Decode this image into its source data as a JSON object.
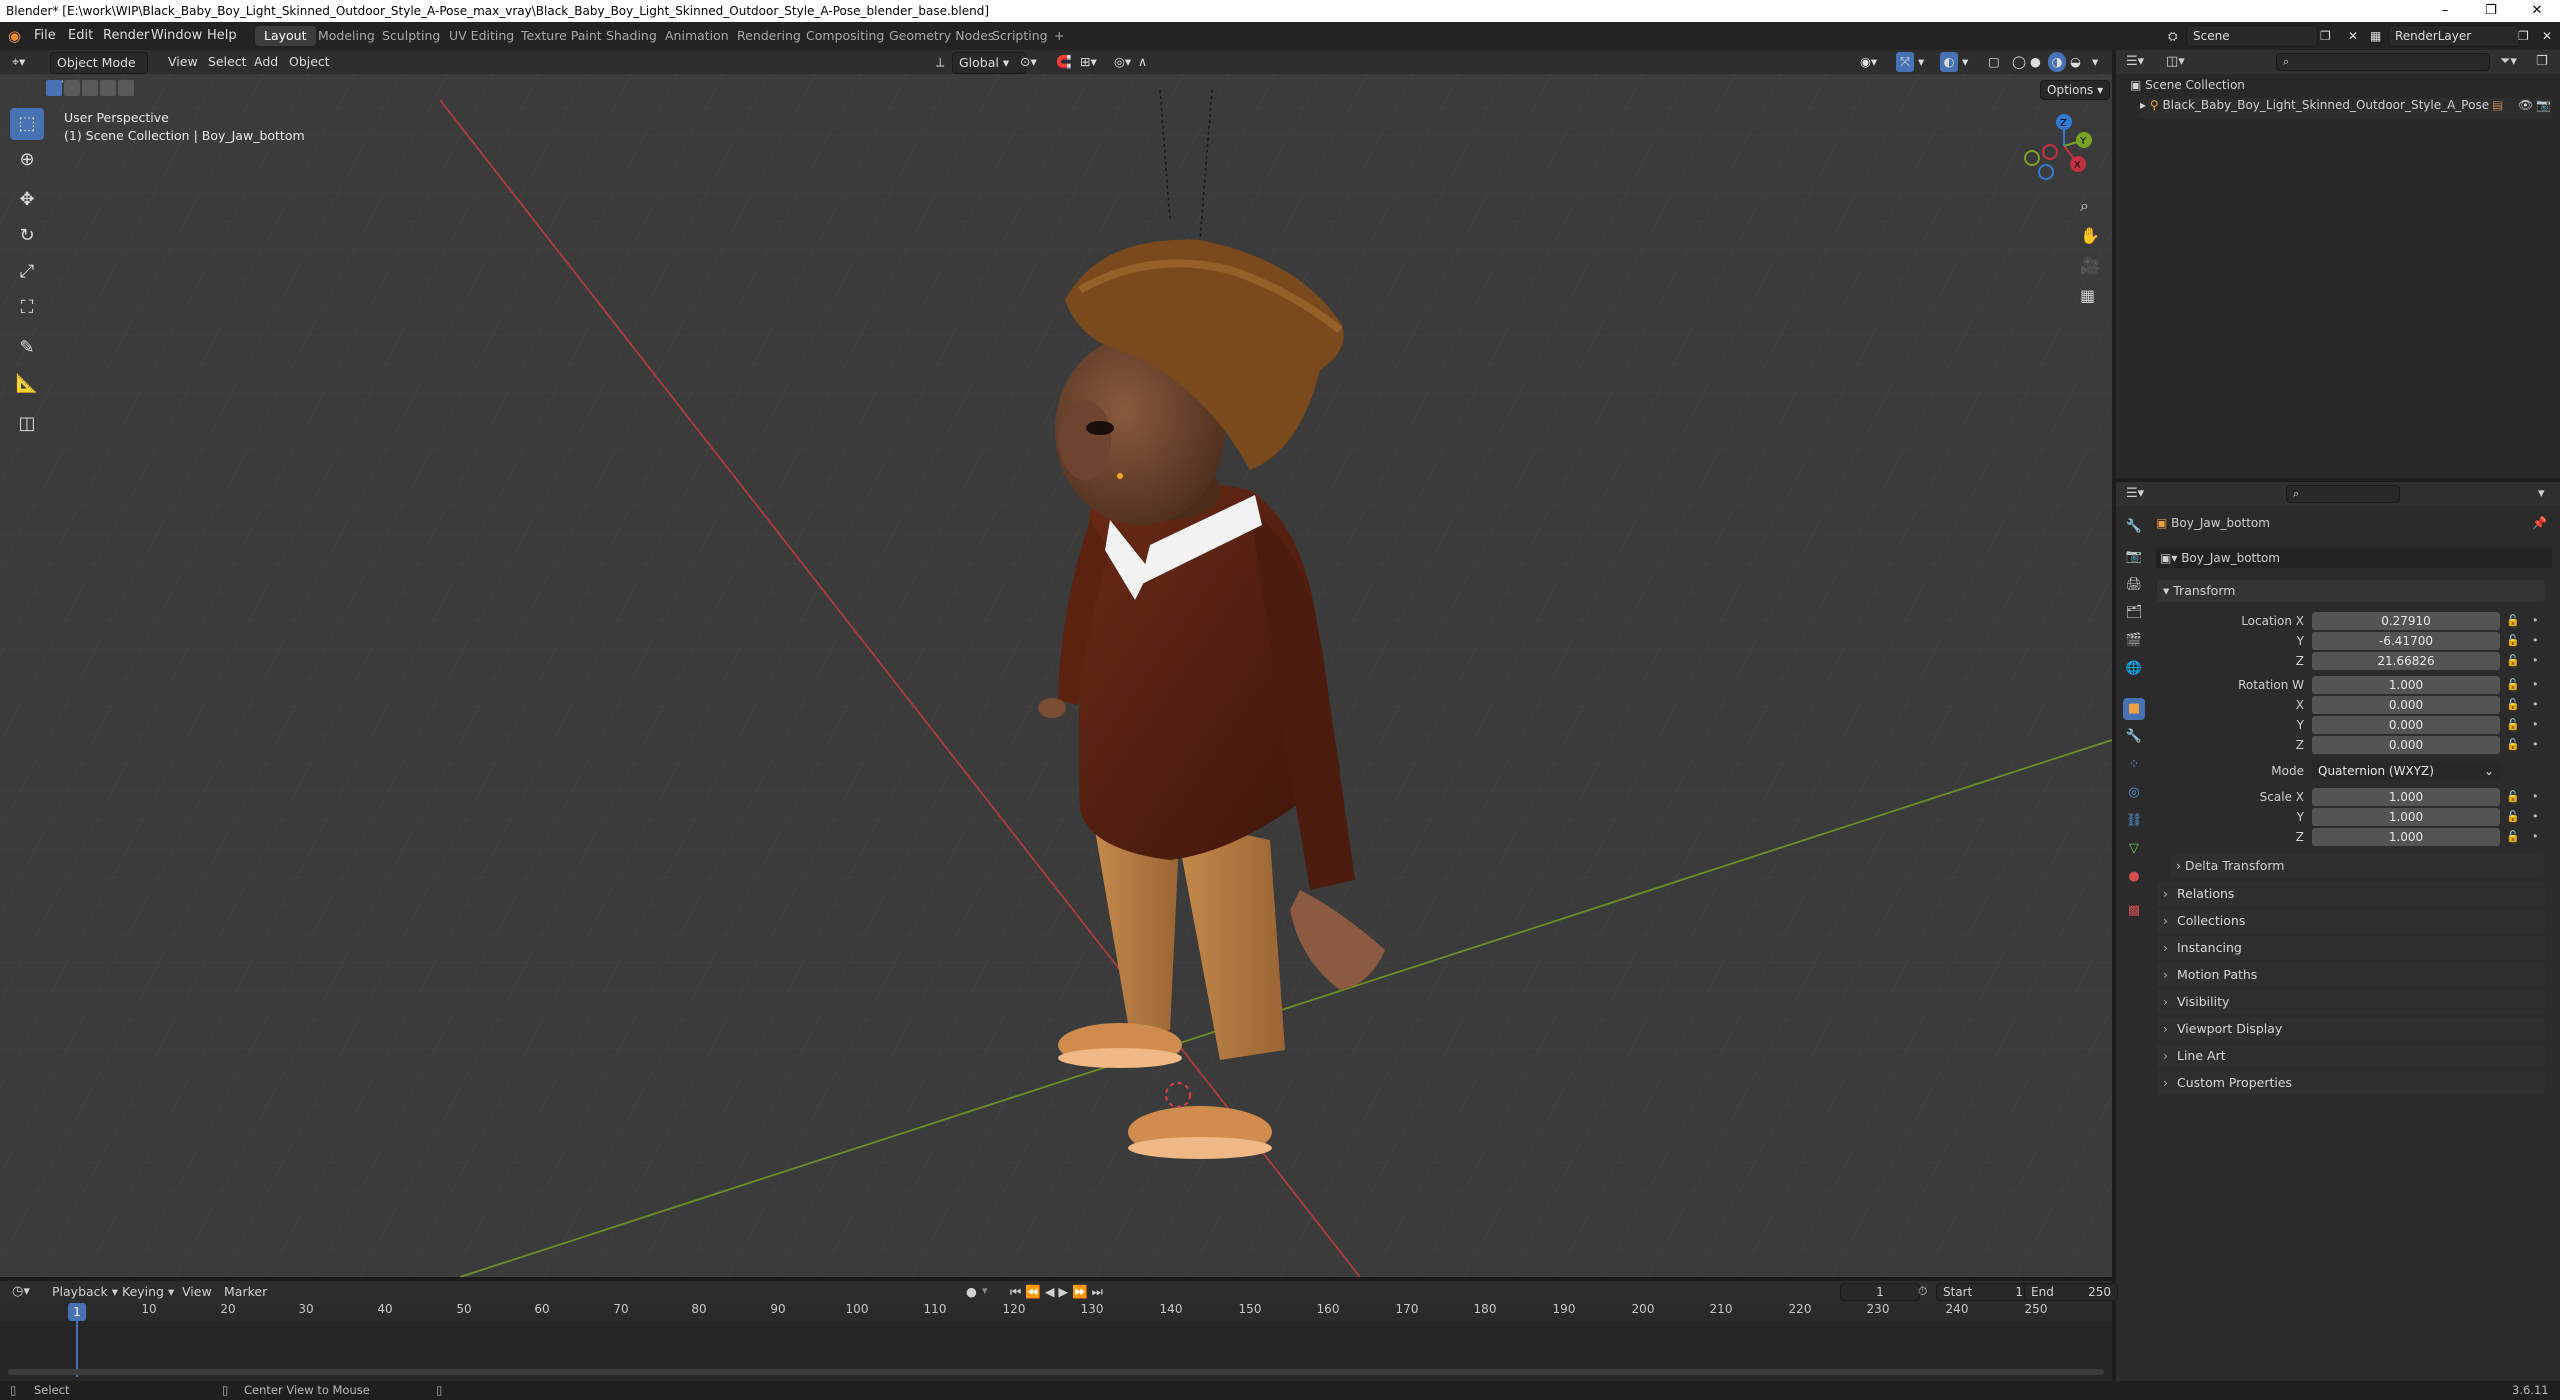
{
  "window": {
    "title": "Blender* [E:\\work\\WIP\\Black_Baby_Boy_Light_Skinned_Outdoor_Style_A-Pose_max_vray\\Black_Baby_Boy_Light_Skinned_Outdoor_Style_A-Pose_blender_base.blend]",
    "minimize": "–",
    "maximize": "❐",
    "close": "✕"
  },
  "menu": [
    "File",
    "Edit",
    "Render",
    "Window",
    "Help"
  ],
  "workspaces": [
    "Layout",
    "Modeling",
    "Sculpting",
    "UV Editing",
    "Texture Paint",
    "Shading",
    "Animation",
    "Rendering",
    "Compositing",
    "Geometry Nodes",
    "Scripting",
    "+"
  ],
  "scene": {
    "label": "Scene",
    "render_layer": "RenderLayer"
  },
  "viewport": {
    "mode": "Object Mode",
    "header_menus": [
      "View",
      "Select",
      "Add",
      "Object"
    ],
    "orientation": "Global",
    "options_label": "Options",
    "overlay_line1": "User Perspective",
    "overlay_line2": "(1) Scene Collection | Boy_Jaw_bottom",
    "gizmo": {
      "x": "X",
      "y": "Y",
      "z": "Z"
    }
  },
  "outliner": {
    "root": "Scene Collection",
    "items": [
      {
        "label": "Black_Baby_Boy_Light_Skinned_Outdoor_Style_A_Pose"
      }
    ]
  },
  "properties": {
    "object_name": "Boy_Jaw_bottom",
    "data_name": "Boy_Jaw_bottom",
    "transform_title": "Transform",
    "location": {
      "label_x": "Location X",
      "label_y": "Y",
      "label_z": "Z",
      "x": "0.27910",
      "y": "-6.41700",
      "z": "21.66826"
    },
    "rotation": {
      "label_w": "Rotation W",
      "label_x": "X",
      "label_y": "Y",
      "label_z": "Z",
      "w": "1.000",
      "x": "0.000",
      "y": "0.000",
      "z": "0.000"
    },
    "mode": {
      "label": "Mode",
      "value": "Quaternion (WXYZ)"
    },
    "scale": {
      "label_x": "Scale X",
      "label_y": "Y",
      "label_z": "Z",
      "x": "1.000",
      "y": "1.000",
      "z": "1.000"
    },
    "delta_transform": "Delta Transform",
    "sections": [
      "Relations",
      "Collections",
      "Instancing",
      "Motion Paths",
      "Visibility",
      "Viewport Display",
      "Line Art",
      "Custom Properties"
    ]
  },
  "timeline": {
    "menus": [
      "Playback",
      "Keying",
      "View",
      "Marker"
    ],
    "current_frame": "1",
    "start_label": "Start",
    "start": "1",
    "end_label": "End",
    "end": "250",
    "ticks": [
      "1",
      "10",
      "20",
      "30",
      "40",
      "50",
      "60",
      "70",
      "80",
      "90",
      "100",
      "110",
      "120",
      "130",
      "140",
      "150",
      "160",
      "170",
      "180",
      "190",
      "200",
      "210",
      "220",
      "230",
      "240",
      "250"
    ]
  },
  "status": {
    "left": "Select",
    "middle": "Center View to Mouse",
    "version": "3.6.11"
  },
  "colors": {
    "accent": "#4772b3",
    "x_axis": "#c3303e",
    "y_axis": "#7aa321",
    "z_axis": "#2f7ad3"
  }
}
